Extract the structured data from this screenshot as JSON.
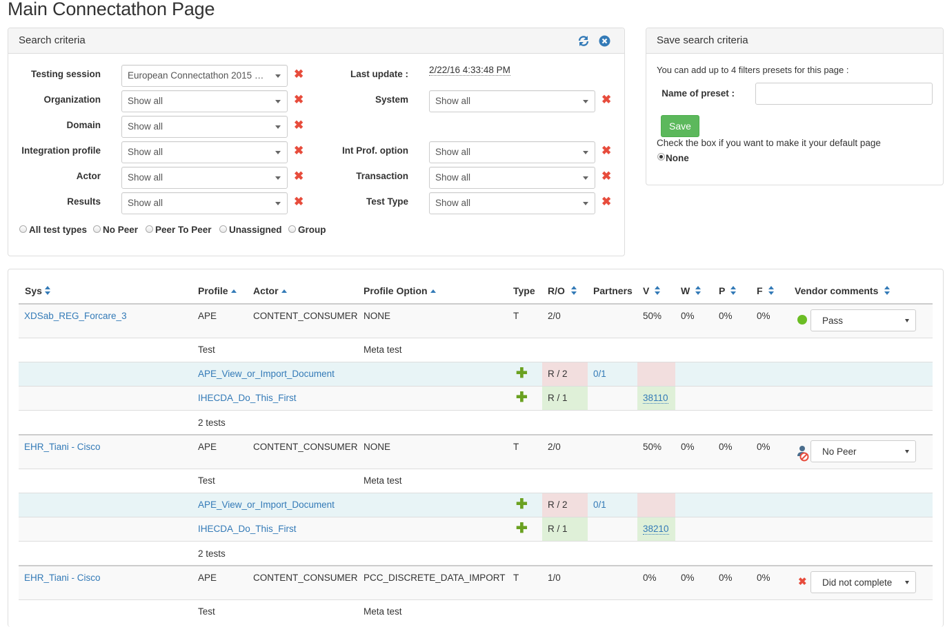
{
  "page_title": "Main Connectathon Page",
  "search": {
    "title": "Search criteria",
    "fields": {
      "testing_session": {
        "label": "Testing session",
        "value": "European Connectathon 2015 - L..."
      },
      "organization": {
        "label": "Organization",
        "value": "Show all"
      },
      "domain": {
        "label": "Domain",
        "value": "Show all"
      },
      "integration_profile": {
        "label": "Integration profile",
        "value": "Show all"
      },
      "actor": {
        "label": "Actor",
        "value": "Show all"
      },
      "results": {
        "label": "Results",
        "value": "Show all"
      },
      "last_update": {
        "label": "Last update :",
        "value": "2/22/16 4:33:48 PM"
      },
      "system": {
        "label": "System",
        "value": "Show all"
      },
      "int_prof_option": {
        "label": "Int Prof. option",
        "value": "Show all"
      },
      "transaction": {
        "label": "Transaction",
        "value": "Show all"
      },
      "test_type": {
        "label": "Test Type",
        "value": "Show all"
      }
    },
    "test_type_radios": [
      "All test types",
      "No Peer",
      "Peer To Peer",
      "Unassigned",
      "Group"
    ]
  },
  "save_search": {
    "title": "Save search criteria",
    "info": "You can add up to 4 filters presets for this page :",
    "preset_label": "Name of preset :",
    "preset_value": "",
    "save_label": "Save",
    "default_hint": "Check the box if you want to make it your default page",
    "none_label": "None"
  },
  "table": {
    "headers": {
      "sys": "Sys",
      "profile": "Profile",
      "actor": "Actor",
      "profile_option": "Profile Option",
      "type": "Type",
      "ro": "R/O",
      "partners": "Partners",
      "v": "V",
      "w": "W",
      "p": "P",
      "f": "F",
      "vendor_comments": "Vendor comments"
    },
    "groups": [
      {
        "sys": "XDSab_REG_Forcare_3",
        "profile": "APE",
        "actor": "CONTENT_CONSUMER",
        "option": "NONE",
        "type": "T",
        "ro": "2/0",
        "v": "50%",
        "w": "0%",
        "p": "0%",
        "f": "0%",
        "status_icon": "green-dot-icon",
        "status": "Pass",
        "test_label": "Test",
        "meta_label": "Meta test",
        "tests": [
          {
            "name": "APE_View_or_Import_Document",
            "ro": "R / 2",
            "partners": "0/1",
            "v": ""
          },
          {
            "name": "IHECDA_Do_This_First",
            "ro": "R / 1",
            "partners": "",
            "v": "38110"
          }
        ],
        "count": "2 tests"
      },
      {
        "sys": "EHR_Tiani - Cisco",
        "profile": "APE",
        "actor": "CONTENT_CONSUMER",
        "option": "NONE",
        "type": "T",
        "ro": "2/0",
        "v": "50%",
        "w": "0%",
        "p": "0%",
        "f": "0%",
        "status_icon": "no-peer-icon",
        "status": "No Peer",
        "test_label": "Test",
        "meta_label": "Meta test",
        "tests": [
          {
            "name": "APE_View_or_Import_Document",
            "ro": "R / 2",
            "partners": "0/1",
            "v": ""
          },
          {
            "name": "IHECDA_Do_This_First",
            "ro": "R / 1",
            "partners": "",
            "v": "38210"
          }
        ],
        "count": "2 tests"
      },
      {
        "sys": "EHR_Tiani - Cisco",
        "profile": "APE",
        "actor": "CONTENT_CONSUMER",
        "option": "PCC_DISCRETE_DATA_IMPORT",
        "type": "T",
        "ro": "1/0",
        "v": "0%",
        "w": "0%",
        "p": "0%",
        "f": "0%",
        "status_icon": "red-x-icon",
        "status": "Did not complete",
        "test_label": "Test",
        "meta_label": "Meta test"
      }
    ]
  },
  "colors": {
    "link": "#337ab7",
    "red_x": "#e74c3c",
    "plus": "#6aa121",
    "save_btn": "#5cb85c",
    "cell_red": "#f2dede",
    "cell_green": "#dff0d8",
    "row_info": "#e8f4f6"
  }
}
